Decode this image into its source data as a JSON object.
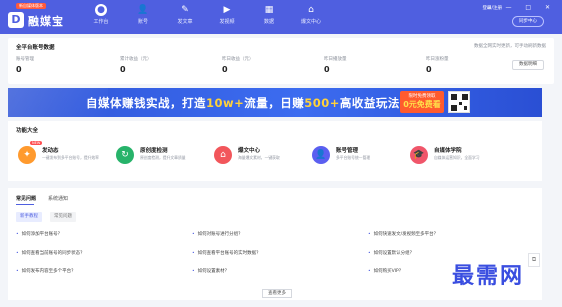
{
  "app": {
    "logo_badge": "新自媒体版本",
    "logo_mark": "D",
    "logo_text": "融媒宝"
  },
  "nav": [
    {
      "label": "工作台",
      "icon": "home-circle-icon",
      "active": true
    },
    {
      "label": "账号",
      "icon": "user-icon"
    },
    {
      "label": "发文章",
      "icon": "pen-icon"
    },
    {
      "label": "发视频",
      "icon": "video-icon"
    },
    {
      "label": "数据",
      "icon": "chart-icon"
    },
    {
      "label": "爆文中心",
      "icon": "home-icon"
    }
  ],
  "header": {
    "user_text": "登录/注册",
    "window_controls": "≡ — □ ✕",
    "sync_button": "同步中心"
  },
  "overview": {
    "title": "全平台账号数据",
    "tip": "数据全网实时更新，可手动刷新数据",
    "more_button": "数据明细",
    "stats": [
      {
        "label": "账号管理",
        "value": "0"
      },
      {
        "label": "累计收益（元）",
        "value": "0"
      },
      {
        "label": "昨日收益（元）",
        "value": "0"
      },
      {
        "label": "昨日播放量",
        "value": "0"
      },
      {
        "label": "昨日涨粉量",
        "value": "0"
      }
    ]
  },
  "banner": {
    "text_pre": "自媒体赚钱实战，打造",
    "text_hl1": "10w+",
    "text_mid": "流量，日赚",
    "text_hl2": "500+",
    "text_post": "高收益玩法",
    "tag_line1": "限时免费领取",
    "tag_line2": "0元免费看"
  },
  "features": {
    "title": "功能大全",
    "items": [
      {
        "name": "发动态",
        "desc": "一键发布到多平台账号，提升效率",
        "icon": "chat-icon",
        "color": "#ff9a2e",
        "new": "NEW"
      },
      {
        "name": "原创度检测",
        "desc": "原创度检测，提升文章质量",
        "icon": "refresh-icon",
        "color": "#27b36a"
      },
      {
        "name": "爆文中心",
        "desc": "海量爆文素材，一键获取",
        "icon": "home-icon",
        "color": "#f2565b"
      },
      {
        "name": "账号管理",
        "desc": "多平台账号统一管理",
        "icon": "user-icon",
        "color": "#5b5ff0"
      },
      {
        "name": "自媒体学院",
        "desc": "自媒体运营知识，全面学习",
        "icon": "graduation-icon",
        "color": "#f0566a"
      }
    ]
  },
  "faq": {
    "tabs": [
      "常见问题",
      "系统通知"
    ],
    "subtabs": [
      "新手教程",
      "常见问题"
    ],
    "questions": [
      "如何添加平台账号？",
      "如何对账号进行分组？",
      "如何快速发文/发视频至多平台？",
      "如何查看当前账号的同步状态？",
      "如何查看平台账号的实时数据？",
      "如何设置默认分组？",
      "如何发布内容至多个平台？",
      "如何设置素材？",
      "如何购买VIP？"
    ],
    "view_more": "查看更多"
  },
  "side_button": "⧉",
  "watermark": "最需网"
}
